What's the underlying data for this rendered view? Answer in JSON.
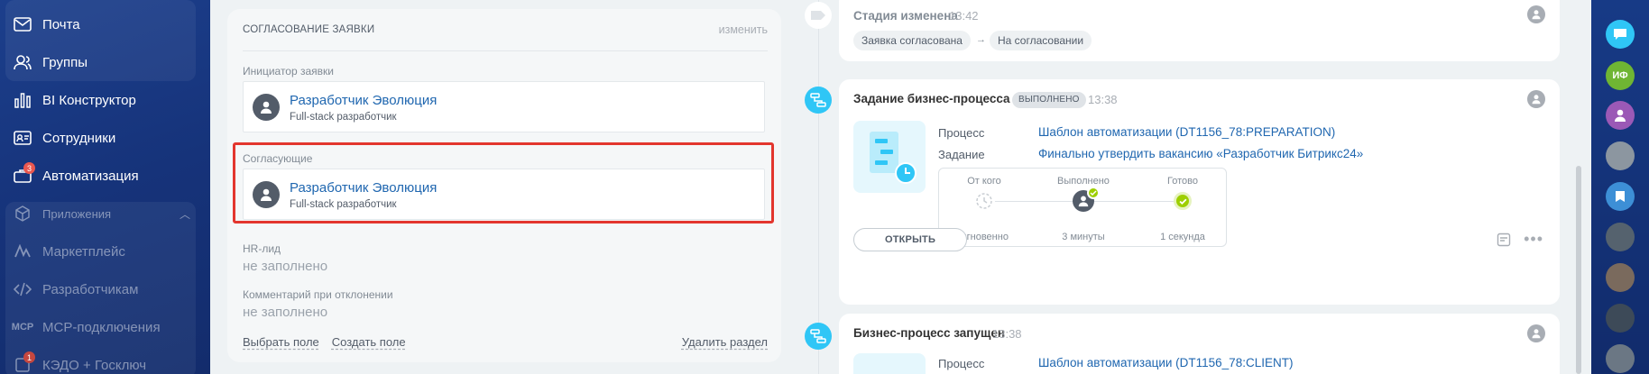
{
  "sidebar": {
    "items": [
      {
        "label": "Почта",
        "icon": "mail-icon"
      },
      {
        "label": "Группы",
        "icon": "groups-icon"
      },
      {
        "label": "BI Конструктор",
        "icon": "bi-chart-icon"
      },
      {
        "label": "Сотрудники",
        "icon": "employees-icon"
      },
      {
        "label": "Автоматизация",
        "icon": "automation-icon",
        "badge": "3"
      },
      {
        "label": "Приложения",
        "icon": "apps-cube-icon"
      },
      {
        "label": "Маркетплейс",
        "icon": "marketplace-icon"
      },
      {
        "label": "Разработчикам",
        "icon": "code-icon"
      },
      {
        "label": "МСР-подключения",
        "icon": "mcp-icon"
      },
      {
        "label": "КЭДО + Госключ",
        "icon": "kedo-icon",
        "badge": "1"
      }
    ]
  },
  "form": {
    "title": "СОГЛАСОВАНИЕ ЗАЯВКИ",
    "edit_label": "изменить",
    "initiator": {
      "label": "Инициатор заявки",
      "name": "Разработчик Эволюция",
      "position": "Full-stack разработчик"
    },
    "approvers": {
      "label": "Согласующие",
      "name": "Разработчик Эволюция",
      "position": "Full-stack разработчик"
    },
    "hr_lead": {
      "label": "HR-лид",
      "value": "не заполнено"
    },
    "reject_comment": {
      "label": "Комментарий при отклонении",
      "value": "не заполнено"
    },
    "links": {
      "choose": "Выбрать поле",
      "create": "Создать поле",
      "delete": "Удалить раздел"
    }
  },
  "timeline": {
    "stage": {
      "title": "Стадия изменена",
      "time": "13:42",
      "from": "Заявка согласована",
      "arrow": "→",
      "to": "На согласовании"
    },
    "task": {
      "title": "Задание бизнес-процесса",
      "status": "ВЫПОЛНЕНО",
      "time": "13:38",
      "process_key": "Процесс",
      "process_val": "Шаблон автоматизации (DT1156_78:PREPARATION)",
      "task_key": "Задание",
      "task_val": "Финально утвердить вакансию «Разработчик Битрикс24»",
      "steps": [
        {
          "top": "От кого",
          "bottom": "мгновенно"
        },
        {
          "top": "Выполнено",
          "bottom": "3 минуты"
        },
        {
          "top": "Готово",
          "bottom": "1 секунда"
        }
      ],
      "open_button": "ОТКРЫТЬ",
      "more": "•••"
    },
    "started": {
      "title": "Бизнес-процесс запущен",
      "time": "13:38",
      "process_key": "Процесс",
      "process_val": "Шаблон автоматизации (DT1156_78:CLIENT)"
    }
  },
  "rightbar": {
    "items": [
      {
        "type": "chat-icon",
        "color": "#2fc6f6"
      },
      {
        "type": "avatar-initials",
        "text": "ИФ",
        "color": "#6fb533"
      },
      {
        "type": "avatar-icon",
        "color": "#9b59b6"
      },
      {
        "type": "avatar-photo",
        "color": "#8c96a0"
      },
      {
        "type": "bookmark-icon",
        "color": "#3d8fd6"
      },
      {
        "type": "avatar-photo",
        "color": "#55626e"
      },
      {
        "type": "avatar-photo",
        "color": "#7a6a5d"
      },
      {
        "type": "avatar-photo",
        "color": "#3d4a58"
      },
      {
        "type": "avatar-photo",
        "color": "#6b7784"
      }
    ]
  }
}
